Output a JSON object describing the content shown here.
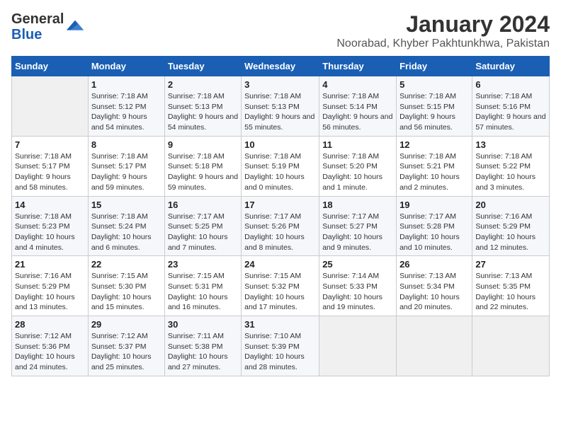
{
  "logo": {
    "text_general": "General",
    "text_blue": "Blue"
  },
  "title": "January 2024",
  "subtitle": "Noorabad, Khyber Pakhtunkhwa, Pakistan",
  "headers": [
    "Sunday",
    "Monday",
    "Tuesday",
    "Wednesday",
    "Thursday",
    "Friday",
    "Saturday"
  ],
  "weeks": [
    [
      {
        "num": "",
        "sunrise": "",
        "sunset": "",
        "daylight": ""
      },
      {
        "num": "1",
        "sunrise": "Sunrise: 7:18 AM",
        "sunset": "Sunset: 5:12 PM",
        "daylight": "Daylight: 9 hours and 54 minutes."
      },
      {
        "num": "2",
        "sunrise": "Sunrise: 7:18 AM",
        "sunset": "Sunset: 5:13 PM",
        "daylight": "Daylight: 9 hours and 54 minutes."
      },
      {
        "num": "3",
        "sunrise": "Sunrise: 7:18 AM",
        "sunset": "Sunset: 5:13 PM",
        "daylight": "Daylight: 9 hours and 55 minutes."
      },
      {
        "num": "4",
        "sunrise": "Sunrise: 7:18 AM",
        "sunset": "Sunset: 5:14 PM",
        "daylight": "Daylight: 9 hours and 56 minutes."
      },
      {
        "num": "5",
        "sunrise": "Sunrise: 7:18 AM",
        "sunset": "Sunset: 5:15 PM",
        "daylight": "Daylight: 9 hours and 56 minutes."
      },
      {
        "num": "6",
        "sunrise": "Sunrise: 7:18 AM",
        "sunset": "Sunset: 5:16 PM",
        "daylight": "Daylight: 9 hours and 57 minutes."
      }
    ],
    [
      {
        "num": "7",
        "sunrise": "Sunrise: 7:18 AM",
        "sunset": "Sunset: 5:17 PM",
        "daylight": "Daylight: 9 hours and 58 minutes."
      },
      {
        "num": "8",
        "sunrise": "Sunrise: 7:18 AM",
        "sunset": "Sunset: 5:17 PM",
        "daylight": "Daylight: 9 hours and 59 minutes."
      },
      {
        "num": "9",
        "sunrise": "Sunrise: 7:18 AM",
        "sunset": "Sunset: 5:18 PM",
        "daylight": "Daylight: 9 hours and 59 minutes."
      },
      {
        "num": "10",
        "sunrise": "Sunrise: 7:18 AM",
        "sunset": "Sunset: 5:19 PM",
        "daylight": "Daylight: 10 hours and 0 minutes."
      },
      {
        "num": "11",
        "sunrise": "Sunrise: 7:18 AM",
        "sunset": "Sunset: 5:20 PM",
        "daylight": "Daylight: 10 hours and 1 minute."
      },
      {
        "num": "12",
        "sunrise": "Sunrise: 7:18 AM",
        "sunset": "Sunset: 5:21 PM",
        "daylight": "Daylight: 10 hours and 2 minutes."
      },
      {
        "num": "13",
        "sunrise": "Sunrise: 7:18 AM",
        "sunset": "Sunset: 5:22 PM",
        "daylight": "Daylight: 10 hours and 3 minutes."
      }
    ],
    [
      {
        "num": "14",
        "sunrise": "Sunrise: 7:18 AM",
        "sunset": "Sunset: 5:23 PM",
        "daylight": "Daylight: 10 hours and 4 minutes."
      },
      {
        "num": "15",
        "sunrise": "Sunrise: 7:18 AM",
        "sunset": "Sunset: 5:24 PM",
        "daylight": "Daylight: 10 hours and 6 minutes."
      },
      {
        "num": "16",
        "sunrise": "Sunrise: 7:17 AM",
        "sunset": "Sunset: 5:25 PM",
        "daylight": "Daylight: 10 hours and 7 minutes."
      },
      {
        "num": "17",
        "sunrise": "Sunrise: 7:17 AM",
        "sunset": "Sunset: 5:26 PM",
        "daylight": "Daylight: 10 hours and 8 minutes."
      },
      {
        "num": "18",
        "sunrise": "Sunrise: 7:17 AM",
        "sunset": "Sunset: 5:27 PM",
        "daylight": "Daylight: 10 hours and 9 minutes."
      },
      {
        "num": "19",
        "sunrise": "Sunrise: 7:17 AM",
        "sunset": "Sunset: 5:28 PM",
        "daylight": "Daylight: 10 hours and 10 minutes."
      },
      {
        "num": "20",
        "sunrise": "Sunrise: 7:16 AM",
        "sunset": "Sunset: 5:29 PM",
        "daylight": "Daylight: 10 hours and 12 minutes."
      }
    ],
    [
      {
        "num": "21",
        "sunrise": "Sunrise: 7:16 AM",
        "sunset": "Sunset: 5:29 PM",
        "daylight": "Daylight: 10 hours and 13 minutes."
      },
      {
        "num": "22",
        "sunrise": "Sunrise: 7:15 AM",
        "sunset": "Sunset: 5:30 PM",
        "daylight": "Daylight: 10 hours and 15 minutes."
      },
      {
        "num": "23",
        "sunrise": "Sunrise: 7:15 AM",
        "sunset": "Sunset: 5:31 PM",
        "daylight": "Daylight: 10 hours and 16 minutes."
      },
      {
        "num": "24",
        "sunrise": "Sunrise: 7:15 AM",
        "sunset": "Sunset: 5:32 PM",
        "daylight": "Daylight: 10 hours and 17 minutes."
      },
      {
        "num": "25",
        "sunrise": "Sunrise: 7:14 AM",
        "sunset": "Sunset: 5:33 PM",
        "daylight": "Daylight: 10 hours and 19 minutes."
      },
      {
        "num": "26",
        "sunrise": "Sunrise: 7:13 AM",
        "sunset": "Sunset: 5:34 PM",
        "daylight": "Daylight: 10 hours and 20 minutes."
      },
      {
        "num": "27",
        "sunrise": "Sunrise: 7:13 AM",
        "sunset": "Sunset: 5:35 PM",
        "daylight": "Daylight: 10 hours and 22 minutes."
      }
    ],
    [
      {
        "num": "28",
        "sunrise": "Sunrise: 7:12 AM",
        "sunset": "Sunset: 5:36 PM",
        "daylight": "Daylight: 10 hours and 24 minutes."
      },
      {
        "num": "29",
        "sunrise": "Sunrise: 7:12 AM",
        "sunset": "Sunset: 5:37 PM",
        "daylight": "Daylight: 10 hours and 25 minutes."
      },
      {
        "num": "30",
        "sunrise": "Sunrise: 7:11 AM",
        "sunset": "Sunset: 5:38 PM",
        "daylight": "Daylight: 10 hours and 27 minutes."
      },
      {
        "num": "31",
        "sunrise": "Sunrise: 7:10 AM",
        "sunset": "Sunset: 5:39 PM",
        "daylight": "Daylight: 10 hours and 28 minutes."
      },
      {
        "num": "",
        "sunrise": "",
        "sunset": "",
        "daylight": ""
      },
      {
        "num": "",
        "sunrise": "",
        "sunset": "",
        "daylight": ""
      },
      {
        "num": "",
        "sunrise": "",
        "sunset": "",
        "daylight": ""
      }
    ]
  ]
}
